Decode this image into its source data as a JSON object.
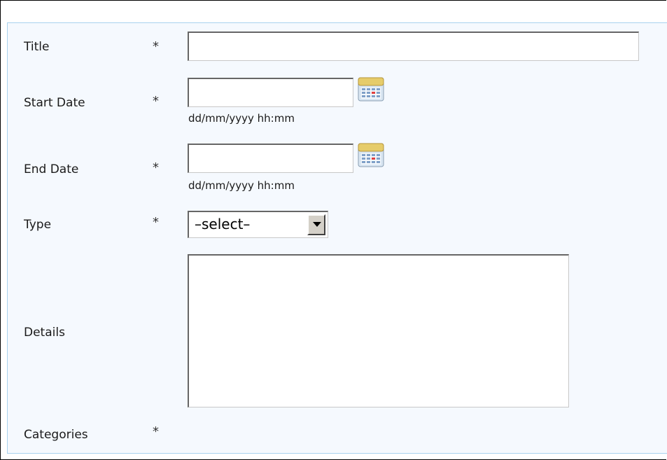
{
  "form": {
    "required_marker": "*",
    "title": {
      "label": "Title",
      "value": ""
    },
    "start_date": {
      "label": "Start Date",
      "value": "",
      "hint": "dd/mm/yyyy hh:mm",
      "calendar_icon": "calendar-icon"
    },
    "end_date": {
      "label": "End Date",
      "value": "",
      "hint": "dd/mm/yyyy hh:mm",
      "calendar_icon": "calendar-icon"
    },
    "type": {
      "label": "Type",
      "selected": "–select–",
      "dropdown_icon": "chevron-down-icon"
    },
    "details": {
      "label": "Details",
      "value": ""
    },
    "categories": {
      "label": "Categories"
    }
  }
}
